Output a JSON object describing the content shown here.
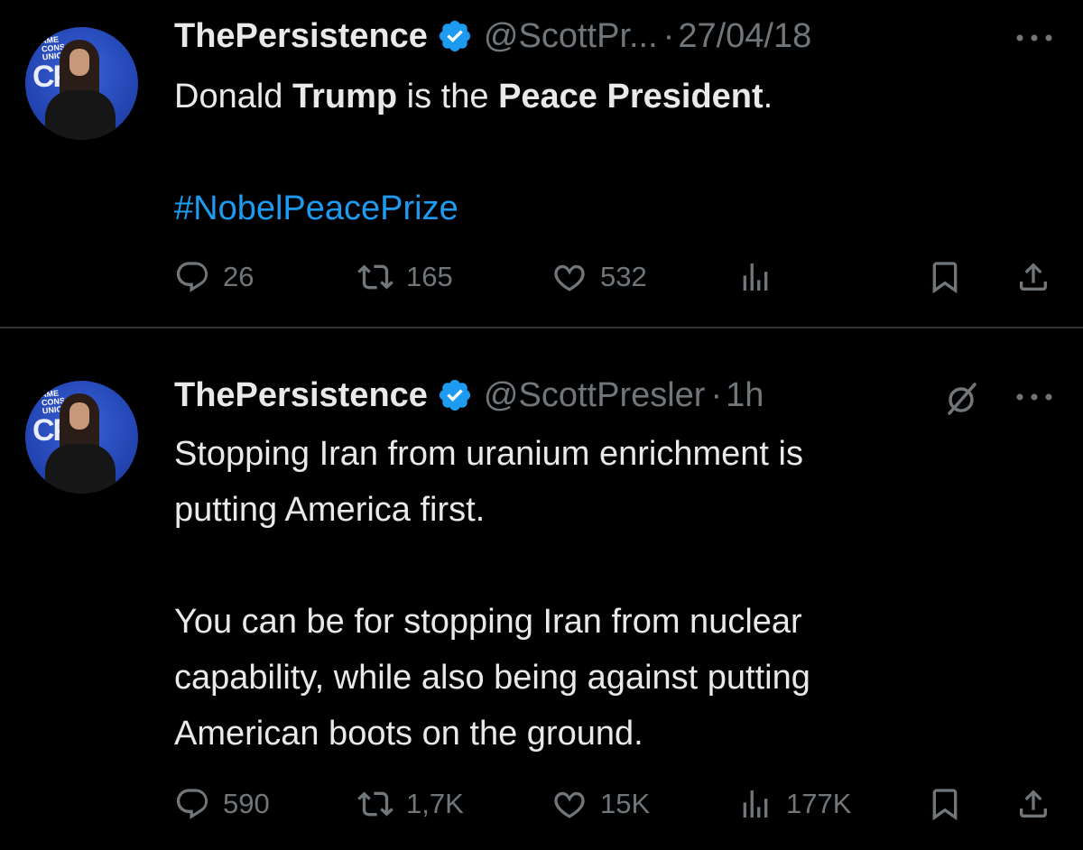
{
  "tweets": [
    {
      "avatar_logo": "AMERICAN CONSERVATIVE UNION",
      "name": "ThePersistence",
      "handle": "@ScottPr...",
      "separator": "·",
      "time": "27/04/18",
      "body": {
        "line1_a": "Donald ",
        "line1_b": "Trump",
        "line1_c": " is the ",
        "line1_d": "Peace President",
        "line1_e": ".",
        "hashtag": "#NobelPeacePrize"
      },
      "actions": {
        "replies": "26",
        "reposts": "165",
        "likes": "532",
        "views": ""
      }
    },
    {
      "avatar_logo": "AMERICAN CONSERVATIVE UNION",
      "name": "ThePersistence",
      "handle": "@ScottPresler",
      "separator": "·",
      "time": "1h",
      "body": {
        "line1": "Stopping Iran from uranium enrichment is",
        "line2": "putting America first.",
        "line3": "You can be for stopping Iran from nuclear",
        "line4": "capability, while also being against putting",
        "line5": "American boots on the ground."
      },
      "actions": {
        "replies": "590",
        "reposts": "1,7K",
        "likes": "15K",
        "views": "177K"
      }
    }
  ],
  "colors": {
    "background": "#000000",
    "text": "#e7e9ea",
    "muted": "#71767b",
    "link": "#1d9bf0",
    "verified": "#1d9bf0"
  },
  "icons": [
    "verified-badge-icon",
    "more-icon",
    "grok-icon",
    "reply-icon",
    "repost-icon",
    "like-icon",
    "views-icon",
    "bookmark-icon",
    "share-icon"
  ]
}
